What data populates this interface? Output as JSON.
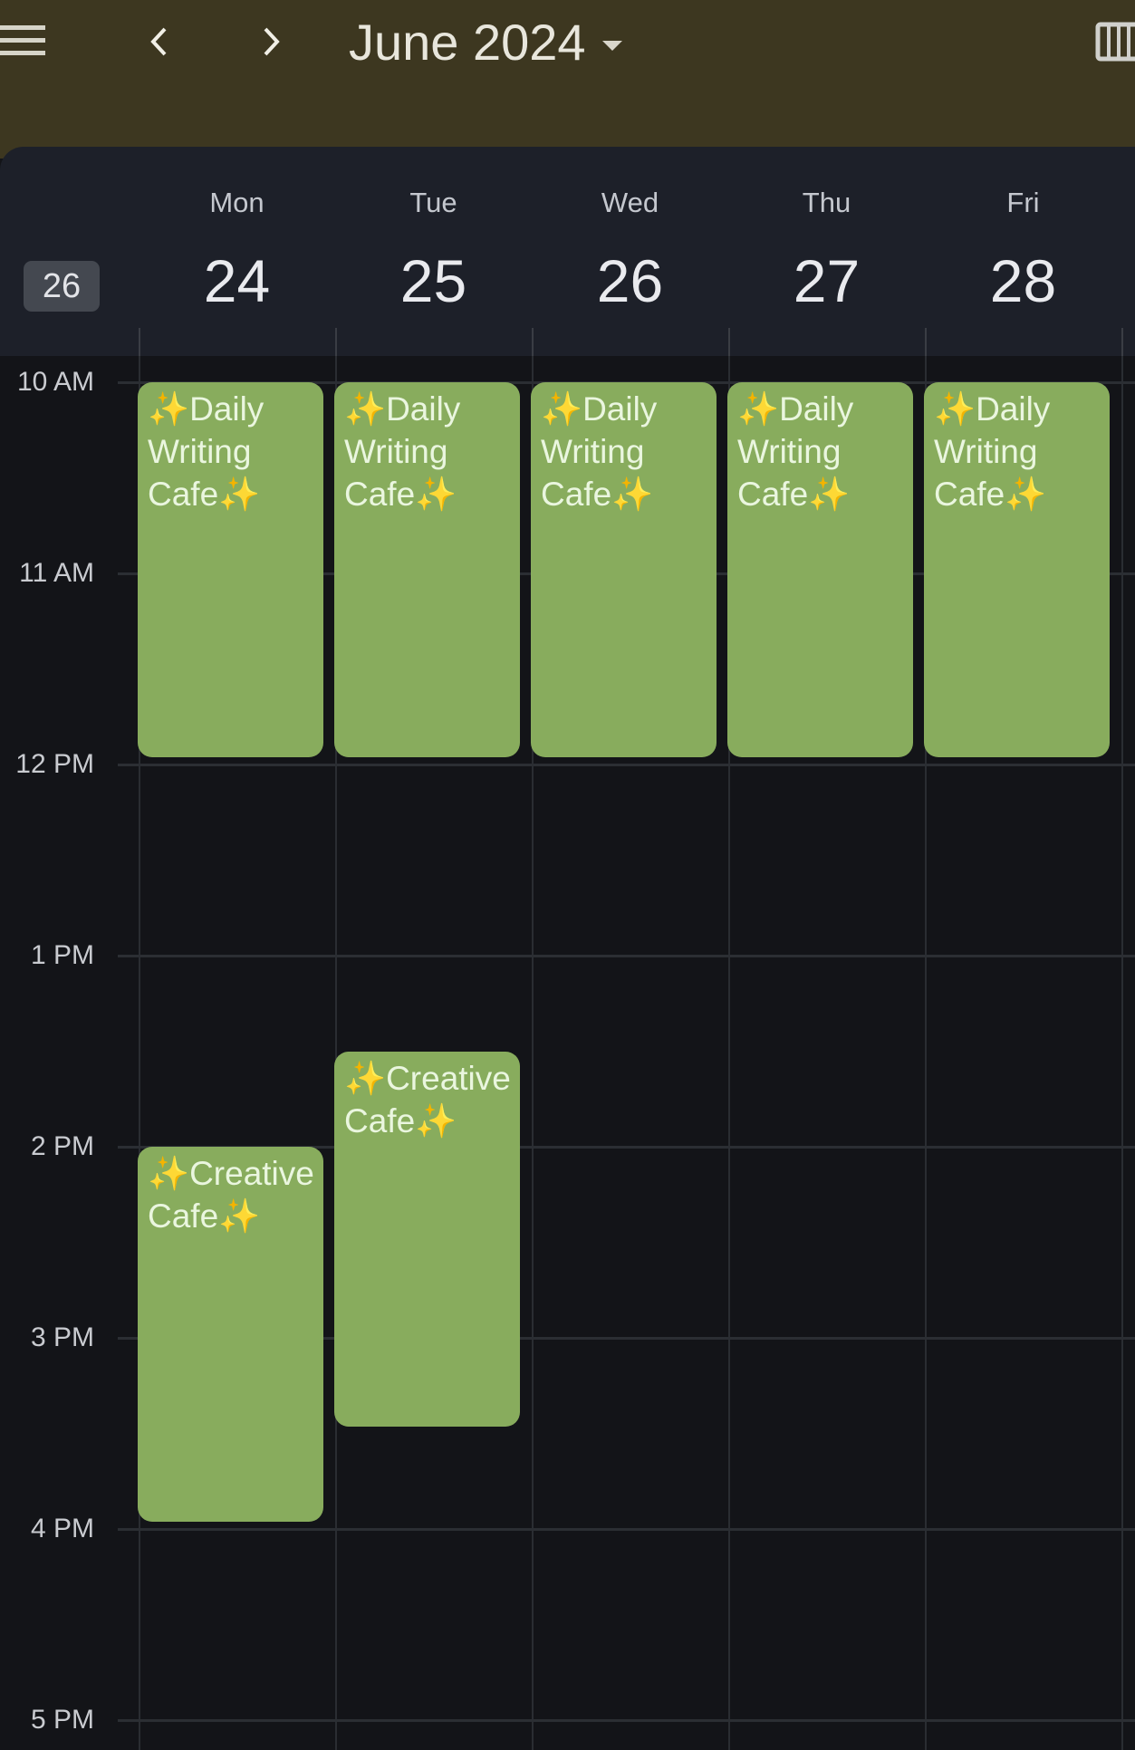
{
  "topbar": {
    "title": "June 2024",
    "icons": [
      "menu-icon",
      "chevron-left-icon",
      "chevron-right-icon",
      "dropdown-caret-icon",
      "week-view-icon"
    ],
    "background": "#3d3720"
  },
  "header": {
    "week_number": "26",
    "days": [
      {
        "name": "Mon",
        "date": "24"
      },
      {
        "name": "Tue",
        "date": "25"
      },
      {
        "name": "Wed",
        "date": "26"
      },
      {
        "name": "Thu",
        "date": "27"
      },
      {
        "name": "Fri",
        "date": "28"
      }
    ]
  },
  "grid": {
    "hours": [
      "10 AM",
      "11 AM",
      "12 PM",
      "1 PM",
      "2 PM",
      "3 PM",
      "4 PM",
      "5 PM"
    ]
  },
  "events": [
    {
      "title": "✨Daily Writing Cafe✨",
      "day": 0,
      "start": 10.0,
      "end": 12.0
    },
    {
      "title": "✨Daily Writing Cafe✨",
      "day": 1,
      "start": 10.0,
      "end": 12.0
    },
    {
      "title": "✨Daily Writing Cafe✨",
      "day": 2,
      "start": 10.0,
      "end": 12.0
    },
    {
      "title": "✨Daily Writing Cafe✨",
      "day": 3,
      "start": 10.0,
      "end": 12.0
    },
    {
      "title": "✨Daily Writing Cafe✨",
      "day": 4,
      "start": 10.0,
      "end": 12.0
    },
    {
      "title": "✨Creative Cafe✨",
      "day": 0,
      "start": 14.0,
      "end": 16.0
    },
    {
      "title": "✨Creative Cafe✨",
      "day": 1,
      "start": 13.5,
      "end": 15.5
    }
  ],
  "colors": {
    "event": "#88ac5d",
    "event_text": "#eaf6df",
    "header_bg": "#1d2029",
    "grid_bg": "#131418"
  }
}
